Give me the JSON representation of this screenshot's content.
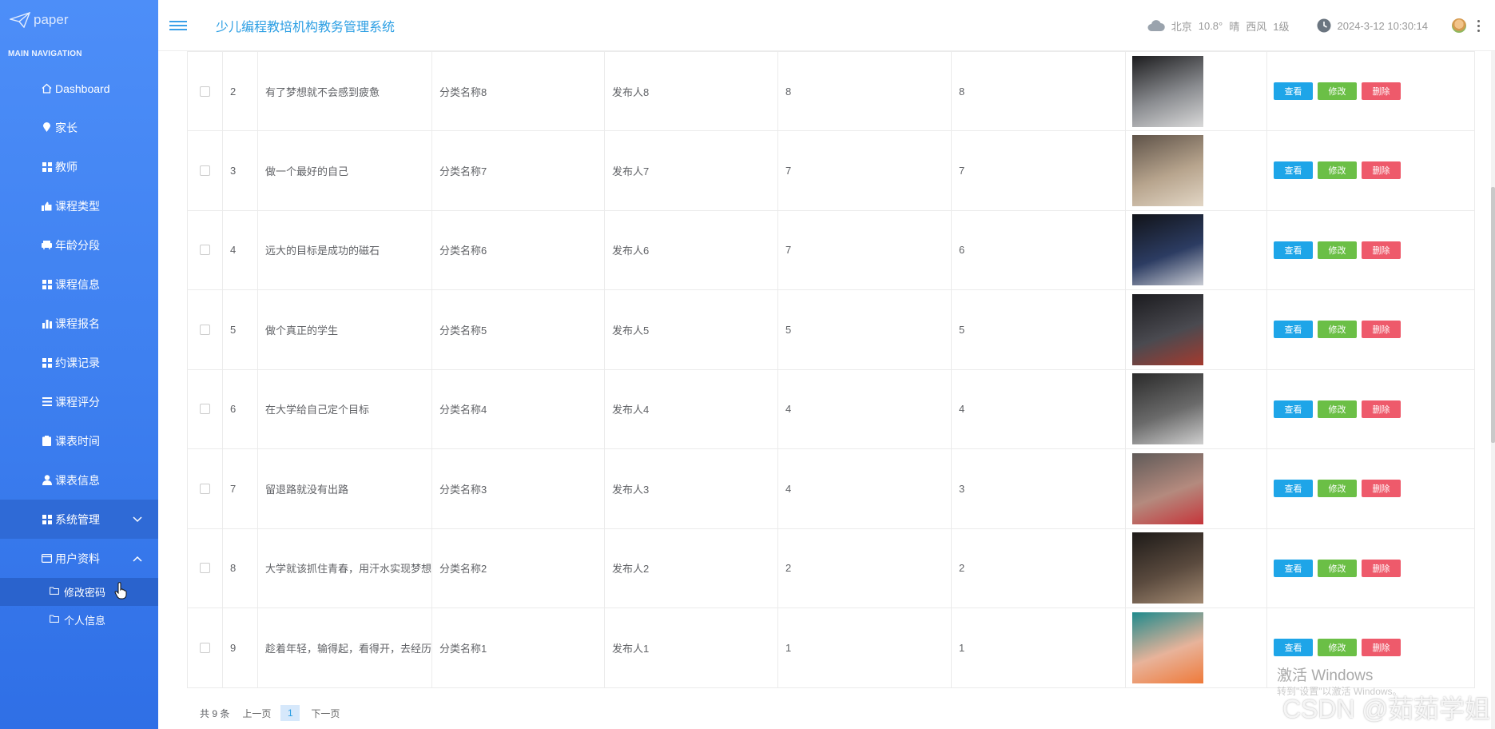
{
  "logo": {
    "text": "paper"
  },
  "sidebar": {
    "caption": "MAIN NAVIGATION",
    "items": [
      {
        "label": "Dashboard",
        "icon": "home-icon"
      },
      {
        "label": "家长",
        "icon": "location-pin-icon"
      },
      {
        "label": "教师",
        "icon": "grid-icon"
      },
      {
        "label": "课程类型",
        "icon": "thumbs-up-icon"
      },
      {
        "label": "年龄分段",
        "icon": "car-icon"
      },
      {
        "label": "课程信息",
        "icon": "grid-icon"
      },
      {
        "label": "课程报名",
        "icon": "bar-chart-icon"
      },
      {
        "label": "约课记录",
        "icon": "grid-icon"
      },
      {
        "label": "课程评分",
        "icon": "list-icon"
      },
      {
        "label": "课表时间",
        "icon": "clipboard-icon"
      },
      {
        "label": "课表信息",
        "icon": "user-icon"
      },
      {
        "label": "系统管理",
        "icon": "grid-icon"
      },
      {
        "label": "用户资料",
        "icon": "card-icon"
      }
    ],
    "sub_items": [
      {
        "label": "修改密码",
        "icon": "folder-icon"
      },
      {
        "label": "个人信息",
        "icon": "folder-icon"
      }
    ]
  },
  "header": {
    "title": "少儿编程教培机构教务管理系统",
    "weather": {
      "city": "北京",
      "temp": "10.8°",
      "condition": "晴",
      "wind": "西风",
      "level": "1级"
    },
    "datetime": "2024-3-12 10:30:14"
  },
  "table": {
    "rows": [
      {
        "idx": "2",
        "title": "有了梦想就不会感到疲惫",
        "category": "分类名称8",
        "publisher": "发布人8",
        "n1": "8",
        "n2": "8",
        "img_colors": [
          "#1c1c1e",
          "#8a8c90",
          "#d9d9d9"
        ]
      },
      {
        "idx": "3",
        "title": "做一个最好的自己",
        "category": "分类名称7",
        "publisher": "发布人7",
        "n1": "7",
        "n2": "7",
        "img_colors": [
          "#5e5248",
          "#b7a48d",
          "#e2d6c5"
        ]
      },
      {
        "idx": "4",
        "title": "远大的目标是成功的磁石",
        "category": "分类名称6",
        "publisher": "发布人6",
        "n1": "7",
        "n2": "6",
        "img_colors": [
          "#111318",
          "#2c3c62",
          "#c8cbd3"
        ]
      },
      {
        "idx": "5",
        "title": "做个真正的学生",
        "category": "分类名称5",
        "publisher": "发布人5",
        "n1": "5",
        "n2": "5",
        "img_colors": [
          "#1b1b1f",
          "#4a4a50",
          "#a53a2e"
        ]
      },
      {
        "idx": "6",
        "title": "在大学给自己定个目标",
        "category": "分类名称4",
        "publisher": "发布人4",
        "n1": "4",
        "n2": "4",
        "img_colors": [
          "#2a2a2a",
          "#6a6a6a",
          "#cfcfcf"
        ]
      },
      {
        "idx": "7",
        "title": "留退路就没有出路",
        "category": "分类名称3",
        "publisher": "发布人3",
        "n1": "4",
        "n2": "3",
        "img_colors": [
          "#5f5a58",
          "#b48a7e",
          "#c6353a"
        ]
      },
      {
        "idx": "8",
        "title": "大学就该抓住青春，用汗水实现梦想",
        "category": "分类名称2",
        "publisher": "发布人2",
        "n1": "2",
        "n2": "2",
        "img_colors": [
          "#1d1a18",
          "#5a4a3e",
          "#a38a72"
        ]
      },
      {
        "idx": "9",
        "title": "趁着年轻，输得起，看得开，去经历",
        "category": "分类名称1",
        "publisher": "发布人1",
        "n1": "1",
        "n2": "1",
        "img_colors": [
          "#1f8a8c",
          "#e8b39a",
          "#ef7a3a"
        ]
      }
    ],
    "actions": {
      "view": "查看",
      "edit": "修改",
      "delete": "删除"
    }
  },
  "pager": {
    "total": "共 9 条",
    "prev": "上一页",
    "current": "1",
    "next": "下一页"
  },
  "overlay": {
    "activate": "激活 Windows",
    "activate_sub": "转到\"设置\"以激活 Windows。",
    "csdn": "CSDN @茹茹学姐"
  },
  "colors": {
    "sidebar": "#3e80f0",
    "accent": "#2b9ee3",
    "view": "#1ea5e8",
    "edit": "#6bbf46",
    "delete": "#ee5a6b"
  }
}
